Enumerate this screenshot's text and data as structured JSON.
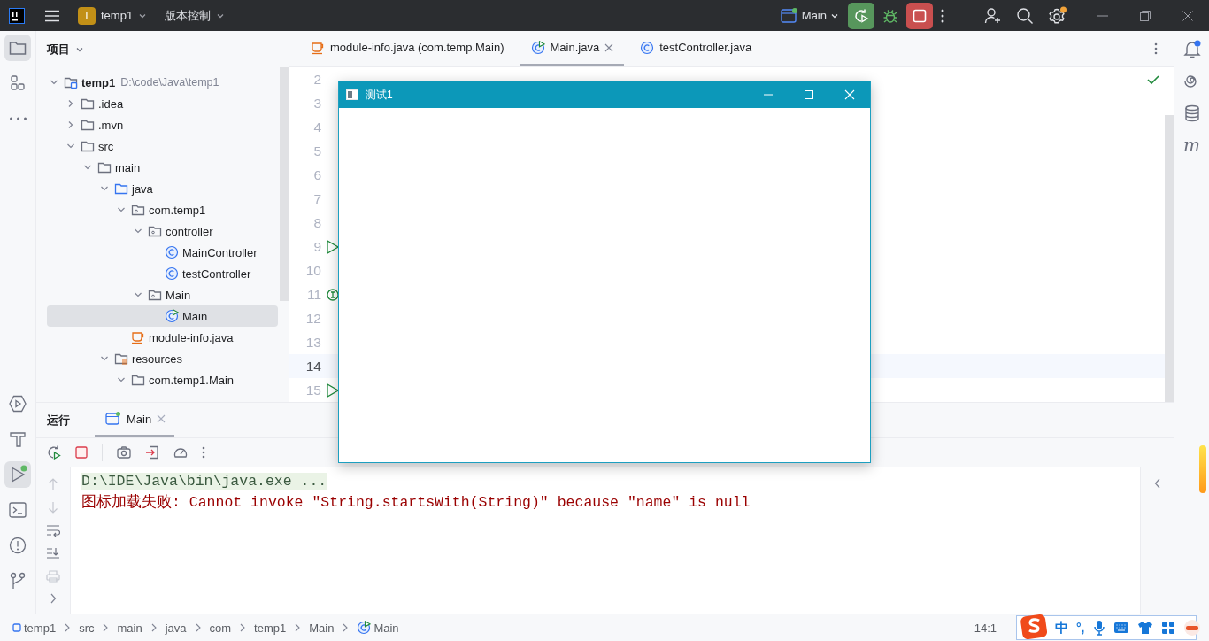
{
  "title_bar": {
    "project_badge": "T",
    "project": "temp1",
    "vcs": "版本控制",
    "run_config": "Main"
  },
  "left_tools": {
    "top": [
      {
        "kind": "project",
        "selected": true
      },
      {
        "kind": "structure",
        "selected": false
      },
      {
        "kind": "more",
        "selected": false
      }
    ],
    "bottom": [
      {
        "kind": "run",
        "selected": false
      },
      {
        "kind": "build",
        "selected": false
      },
      {
        "kind": "run-active",
        "selected": true
      },
      {
        "kind": "terminal",
        "selected": false
      },
      {
        "kind": "problems",
        "selected": false
      },
      {
        "kind": "git",
        "selected": false
      }
    ]
  },
  "project_panel": {
    "title": "项目",
    "tree": [
      {
        "label": "temp1",
        "path": "D:\\code\\Java\\temp1",
        "kind": "module",
        "expanded": true,
        "selected": false,
        "children": [
          {
            "label": ".idea",
            "kind": "folder",
            "expanded": false,
            "selected": false
          },
          {
            "label": ".mvn",
            "kind": "folder",
            "expanded": false,
            "selected": false
          },
          {
            "label": "src",
            "kind": "folder",
            "expanded": true,
            "selected": false,
            "children": [
              {
                "label": "main",
                "kind": "folder",
                "expanded": true,
                "selected": false,
                "children": [
                  {
                    "label": "java",
                    "kind": "source",
                    "expanded": true,
                    "selected": false,
                    "children": [
                      {
                        "label": "com.temp1",
                        "kind": "package",
                        "expanded": true,
                        "selected": false,
                        "children": [
                          {
                            "label": "controller",
                            "kind": "package",
                            "expanded": true,
                            "selected": false,
                            "children": [
                              {
                                "label": "MainController",
                                "kind": "class",
                                "selected": false
                              },
                              {
                                "label": "testController",
                                "kind": "class",
                                "selected": false
                              }
                            ]
                          },
                          {
                            "label": "Main",
                            "kind": "package",
                            "expanded": true,
                            "selected": false,
                            "children": [
                              {
                                "label": "Main",
                                "kind": "main-class",
                                "selected": true
                              }
                            ]
                          }
                        ]
                      },
                      {
                        "label": "module-info.java",
                        "kind": "module-info",
                        "selected": false
                      }
                    ]
                  },
                  {
                    "label": "resources",
                    "kind": "resources",
                    "expanded": true,
                    "selected": false,
                    "children": [
                      {
                        "label": "com.temp1.Main",
                        "kind": "folder",
                        "expanded": true,
                        "selected": false
                      }
                    ]
                  }
                ]
              }
            ]
          }
        ]
      }
    ]
  },
  "editor": {
    "tabs": [
      {
        "label": "module-info.java (com.temp.Main)",
        "kind": "module-info",
        "selected": false,
        "closable": false
      },
      {
        "label": "Main.java",
        "kind": "main-class",
        "selected": true,
        "closable": true
      },
      {
        "label": "testController.java",
        "kind": "class",
        "selected": false,
        "closable": false
      }
    ],
    "lines": [
      {
        "number": "2",
        "kind": "plain",
        "current": false
      },
      {
        "number": "3",
        "kind": "plain",
        "current": false
      },
      {
        "number": "4",
        "kind": "plain",
        "current": false
      },
      {
        "number": "5",
        "kind": "plain",
        "current": false
      },
      {
        "number": "6",
        "kind": "plain",
        "current": false
      },
      {
        "number": "7",
        "kind": "plain",
        "current": false
      },
      {
        "number": "8",
        "kind": "plain",
        "current": false
      },
      {
        "number": "9",
        "kind": "run",
        "current": false
      },
      {
        "number": "10",
        "kind": "plain",
        "current": false
      },
      {
        "number": "11",
        "kind": "implements",
        "current": false
      },
      {
        "number": "12",
        "kind": "plain",
        "current": false
      },
      {
        "number": "13",
        "kind": "plain",
        "current": false
      },
      {
        "number": "14",
        "kind": "plain",
        "current": true
      },
      {
        "number": "15",
        "kind": "run",
        "current": false
      }
    ]
  },
  "right_tools": [
    {
      "kind": "notifications"
    },
    {
      "kind": "ai"
    },
    {
      "kind": "database"
    },
    {
      "kind": "maven",
      "label": "m"
    }
  ],
  "dialog": {
    "title": "测试1"
  },
  "run_panel": {
    "title": "运行",
    "tabs": [
      {
        "label": "Main",
        "selected": true
      }
    ],
    "console": [
      {
        "kind": "command",
        "text": "D:\\IDE\\Java\\bin\\java.exe ..."
      },
      {
        "kind": "error",
        "text": "图标加载失败: Cannot invoke \"String.startsWith(String)\" because \"name\" is null"
      }
    ]
  },
  "status_bar": {
    "breadcrumbs": [
      {
        "label": "temp1",
        "kind": "module"
      },
      {
        "label": "src"
      },
      {
        "label": "main"
      },
      {
        "label": "java"
      },
      {
        "label": "com"
      },
      {
        "label": "temp1"
      },
      {
        "label": "Main"
      },
      {
        "label": "Main",
        "kind": "main-class"
      }
    ],
    "position": "14:1"
  },
  "ime_bar": {
    "mode": "中",
    "punctuation": "°,"
  }
}
